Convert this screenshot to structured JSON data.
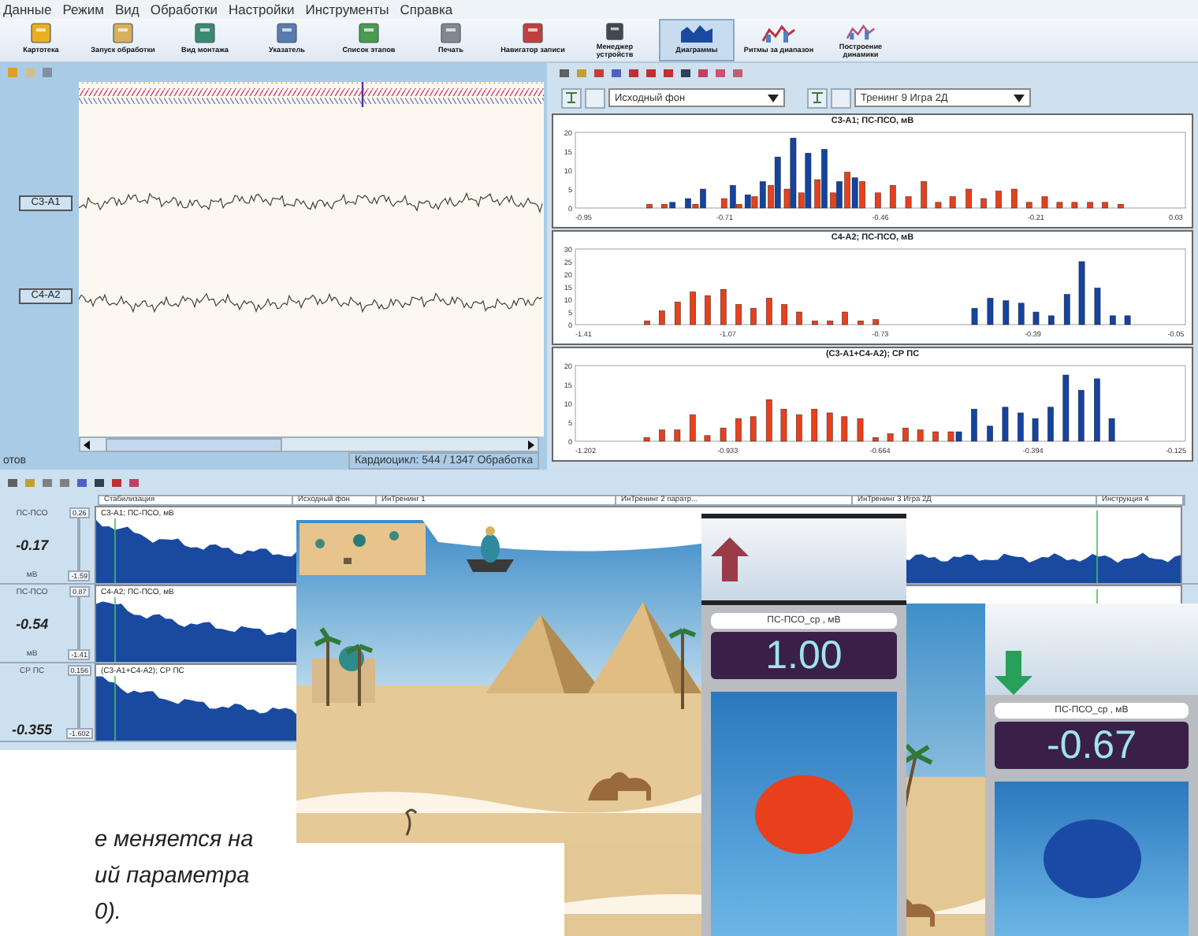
{
  "menu": [
    "Данные",
    "Режим",
    "Вид",
    "Обработки",
    "Настройки",
    "Инструменты",
    "Справка"
  ],
  "toolbar": [
    {
      "label": "Картотека"
    },
    {
      "label": "Запуск обработки"
    },
    {
      "label": "Вид монтажа"
    },
    {
      "label": "Указатель"
    },
    {
      "label": "Список этапов"
    },
    {
      "label": "Печать"
    },
    {
      "label": "Навигатор записи"
    },
    {
      "label": "Менеджер устройств"
    },
    {
      "label": "Диаграммы",
      "selected": true
    },
    {
      "label": "Ритмы за диапазон",
      "selected": false
    },
    {
      "label": "Построение динамики",
      "selected": false
    }
  ],
  "eeg_window": {
    "channels": [
      {
        "label": "C3-A1"
      },
      {
        "label": "C4-A2"
      }
    ],
    "status": "отов",
    "status_info": "Кардиоцикл: 544 / 1347 Обработка"
  },
  "histogram_panel": {
    "dropdowns": [
      {
        "value": "Исходный фон"
      },
      {
        "value": "Тренинг 9 Игра 2Д"
      }
    ],
    "charts": [
      {
        "chart_data": {
          "type": "bar",
          "title": "C3-A1; ПС-ПСО, мВ",
          "xlim": [
            -0.95,
            0.03
          ],
          "ylim": [
            0,
            20
          ],
          "xticks": [
            -0.95,
            -0.71,
            -0.46,
            -0.21,
            0.03
          ],
          "yticks": [
            0,
            5,
            10,
            15,
            20
          ],
          "x": [
            -0.831,
            -0.807,
            -0.794,
            -0.769,
            -0.757,
            -0.745,
            -0.711,
            -0.697,
            -0.687,
            -0.673,
            -0.662,
            -0.649,
            -0.636,
            -0.625,
            -0.61,
            -0.6,
            -0.587,
            -0.576,
            -0.561,
            -0.55,
            -0.536,
            -0.526,
            -0.513,
            -0.501,
            -0.489,
            -0.464,
            -0.44,
            -0.415,
            -0.39,
            -0.367,
            -0.344,
            -0.318,
            -0.294,
            -0.27,
            -0.245,
            -0.221,
            -0.196,
            -0.172,
            -0.148,
            -0.123,
            -0.099,
            -0.074
          ],
          "series": [
            {
              "color": "#e8401c",
              "values": [
                1,
                1,
                null,
                null,
                1,
                null,
                2.5,
                null,
                1,
                null,
                3,
                null,
                6,
                null,
                5,
                null,
                4,
                null,
                7.5,
                null,
                4,
                null,
                9.5,
                null,
                7,
                4,
                6,
                3,
                7,
                1.5,
                3,
                5,
                2.5,
                4.5,
                5,
                1.5,
                3,
                1.5,
                1.5,
                1.5,
                1.5,
                1
              ]
            },
            {
              "color": "#1443a0",
              "values": [
                null,
                null,
                1.5,
                2.5,
                null,
                5,
                null,
                6,
                null,
                3.5,
                null,
                7,
                null,
                13.5,
                null,
                18.5,
                null,
                14.5,
                null,
                15.5,
                null,
                7,
                null,
                8,
                null,
                null,
                null,
                null,
                null,
                null,
                null,
                null,
                null,
                null,
                null,
                null,
                null,
                null,
                null,
                null,
                null,
                null
              ]
            }
          ]
        }
      },
      {
        "chart_data": {
          "type": "bar",
          "title": "C4-A2; ПС-ПСО, мВ",
          "xlim": [
            -1.41,
            -0.05
          ],
          "ylim": [
            0,
            30
          ],
          "xticks": [
            -1.41,
            -1.07,
            -0.73,
            -0.39,
            -0.05
          ],
          "yticks": [
            0,
            5,
            10,
            15,
            20,
            25,
            30
          ],
          "x": [
            -1.25,
            -1.217,
            -1.182,
            -1.148,
            -1.115,
            -1.08,
            -1.046,
            -1.013,
            -0.978,
            -0.944,
            -0.911,
            -0.876,
            -0.842,
            -0.809,
            -0.774,
            -0.74,
            -0.52,
            -0.485,
            -0.45,
            -0.416,
            -0.383,
            -0.349,
            -0.314,
            -0.281,
            -0.246,
            -0.212,
            -0.179
          ],
          "series": [
            {
              "color": "#e8401c",
              "values": [
                1.5,
                5.5,
                9,
                13,
                11.5,
                14,
                8,
                6.5,
                10.5,
                8,
                5,
                1.5,
                1.5,
                5,
                1.5,
                2,
                null,
                null,
                null,
                null,
                null,
                null,
                null,
                null,
                null,
                null,
                null
              ]
            },
            {
              "color": "#1443a0",
              "values": [
                null,
                null,
                null,
                null,
                null,
                null,
                null,
                null,
                null,
                null,
                null,
                null,
                null,
                null,
                null,
                null,
                6.5,
                10.5,
                9.5,
                8.5,
                5,
                3.5,
                12,
                25,
                14.5,
                3.5,
                3.5
              ]
            }
          ]
        }
      },
      {
        "chart_data": {
          "type": "bar",
          "title": "(C3-A1+C4-A2); СР ПС",
          "xlim": [
            -1.202,
            -0.125
          ],
          "ylim": [
            0,
            20
          ],
          "xticks": [
            -1.202,
            -0.933,
            -0.664,
            -0.394,
            -0.125
          ],
          "yticks": [
            0,
            5,
            10,
            15,
            20
          ],
          "x": [
            -1.076,
            -1.049,
            -1.022,
            -0.995,
            -0.969,
            -0.941,
            -0.914,
            -0.888,
            -0.86,
            -0.834,
            -0.807,
            -0.78,
            -0.753,
            -0.727,
            -0.699,
            -0.672,
            -0.646,
            -0.619,
            -0.593,
            -0.566,
            -0.539,
            -0.525,
            -0.498,
            -0.47,
            -0.443,
            -0.416,
            -0.39,
            -0.363,
            -0.336,
            -0.309,
            -0.281,
            -0.255
          ],
          "series": [
            {
              "color": "#e8401c",
              "values": [
                1,
                3,
                3,
                7,
                1.5,
                3.5,
                6,
                6.5,
                11,
                8.5,
                7,
                8.5,
                7.5,
                6.5,
                6,
                1,
                2,
                3.5,
                3,
                2.5,
                2.5,
                null,
                null,
                null,
                null,
                null,
                null,
                null,
                null,
                null,
                null,
                null
              ]
            },
            {
              "color": "#1443a0",
              "values": [
                null,
                null,
                null,
                null,
                null,
                null,
                null,
                null,
                null,
                null,
                null,
                null,
                null,
                null,
                null,
                null,
                null,
                null,
                null,
                null,
                null,
                2.5,
                8.5,
                4,
                9,
                7.5,
                6,
                9,
                17.5,
                13.5,
                16.5,
                6
              ]
            }
          ]
        }
      }
    ]
  },
  "trend_window": {
    "stages": [
      "Стабилизация",
      "Исходный фон",
      "ИнТренинг 1",
      "ИнТренинг 2 паратр...",
      "ИнТренинг 3 Игра 2Д",
      "Инструкция 4"
    ],
    "meters": [
      {
        "name": "ПС-ПСО",
        "value": "-0.17",
        "unit": "мВ",
        "scale_max": "0.26",
        "scale_min": "-1.59",
        "plot_title": "C3-A1; ПС-ПСО, мВ"
      },
      {
        "name": "ПС-ПСО",
        "value": "-0.54",
        "unit": "мВ",
        "scale_max": "0.87",
        "scale_min": "-1.41",
        "plot_title": "C4-A2; ПС-ПСО, мВ"
      },
      {
        "name": "СР ПС",
        "value": "-0.355",
        "scale_max": "0.156",
        "scale_min": "-1.602",
        "plot_title": "(C3-A1+C4-A2); СР ПС"
      }
    ]
  },
  "feedback_panels": [
    {
      "kind": "up",
      "label": "ПС-ПСО_ср , мВ",
      "value": "1.00",
      "color": "#e8401c"
    },
    {
      "kind": "down",
      "label": "ПС-ПСО_ср , мВ",
      "value": "-0.67",
      "color": "#1a4aa6"
    }
  ],
  "document_text": {
    "lines": [
      "е меняется на",
      "ий параметра",
      "0)."
    ]
  }
}
